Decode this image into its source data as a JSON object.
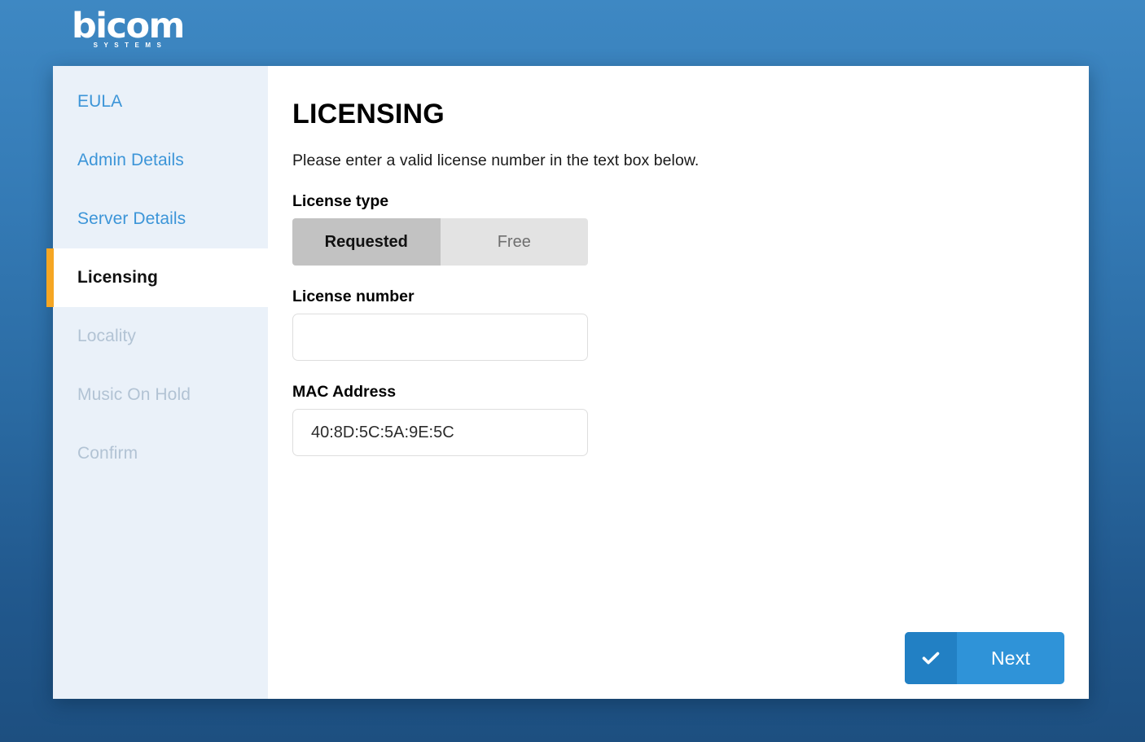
{
  "brand": {
    "logo_word": "bicom",
    "logo_subtitle": "SYSTEMS",
    "accent_color": "#2f93d8",
    "active_stripe_color": "#f5a623"
  },
  "sidebar": {
    "items": [
      {
        "label": "EULA",
        "state": "completed"
      },
      {
        "label": "Admin Details",
        "state": "completed"
      },
      {
        "label": "Server Details",
        "state": "completed"
      },
      {
        "label": "Licensing",
        "state": "active"
      },
      {
        "label": "Locality",
        "state": "disabled"
      },
      {
        "label": "Music On Hold",
        "state": "disabled"
      },
      {
        "label": "Confirm",
        "state": "disabled"
      }
    ]
  },
  "main": {
    "title": "LICENSING",
    "intro": "Please enter a valid license number in the text box below.",
    "license_type": {
      "label": "License type",
      "options": [
        {
          "label": "Requested",
          "selected": true
        },
        {
          "label": "Free",
          "selected": false
        }
      ]
    },
    "license_number": {
      "label": "License number",
      "value": "",
      "placeholder": ""
    },
    "mac_address": {
      "label": "MAC Address",
      "value": "40:8D:5C:5A:9E:5C",
      "placeholder": ""
    }
  },
  "footer": {
    "next_label": "Next",
    "next_icon": "check-icon"
  }
}
